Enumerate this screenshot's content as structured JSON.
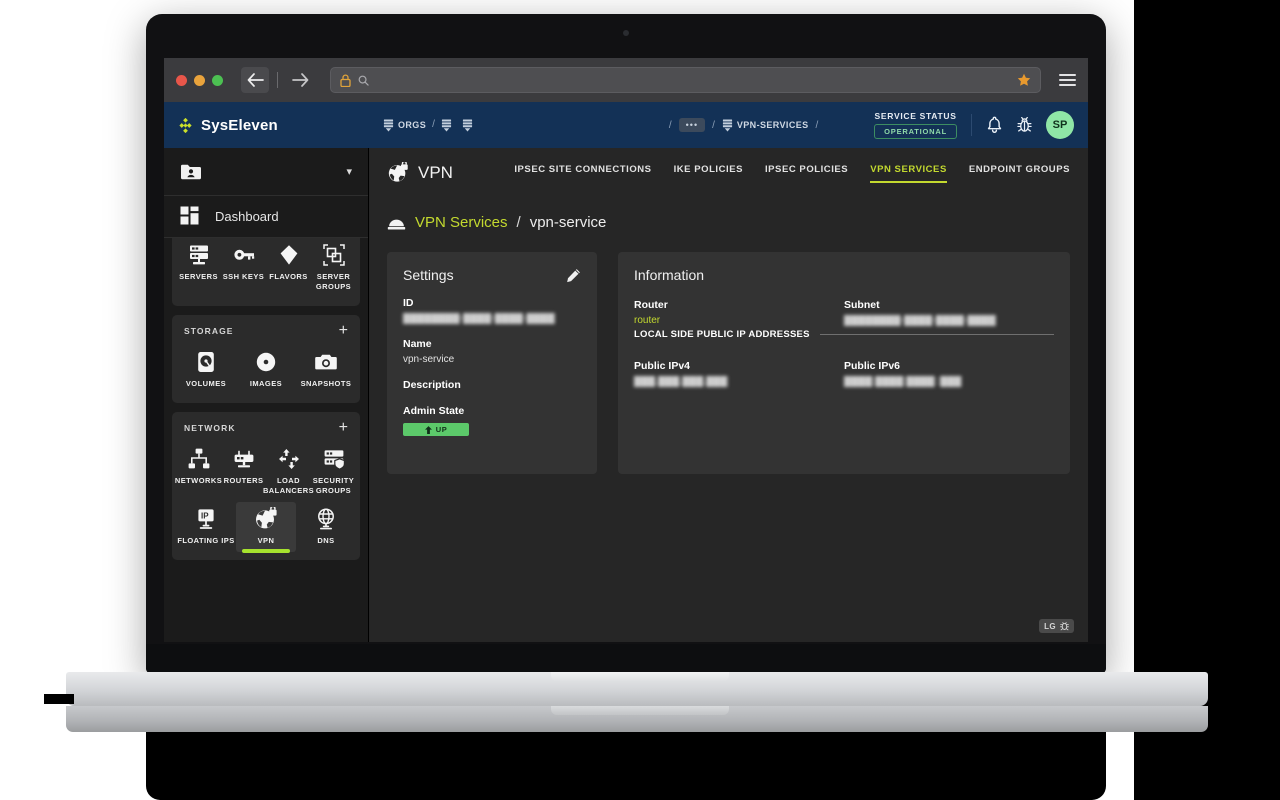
{
  "browser": {
    "traffic_lights": [
      "close",
      "minimize",
      "maximize"
    ],
    "back_icon": "arrow-left-icon",
    "forward_icon": "arrow-right-icon",
    "lock_icon": "lock-icon",
    "search_icon": "search-icon",
    "url_value": "",
    "url_placeholder": "",
    "bookmark_icon": "star-icon",
    "menu_icon": "hamburger-menu-icon"
  },
  "topbar": {
    "brand": "SysEleven",
    "brand_logo_icon": "syseleven-diamond-logo",
    "breadcrumb_left": [
      {
        "icon": "orgs-icon",
        "label": "ORGS"
      },
      {
        "icon": "project-icon",
        "label": ""
      },
      {
        "icon": "project-icon",
        "label": ""
      }
    ],
    "breadcrumb_center": [
      {
        "type": "sep",
        "label": "/"
      },
      {
        "type": "chip",
        "label": "•••"
      },
      {
        "type": "sep",
        "label": "/"
      },
      {
        "type": "item",
        "icon": "vpn-services-icon",
        "label": "VPN-SERVICES"
      },
      {
        "type": "sep",
        "label": "/"
      }
    ],
    "service_status_label": "SERVICE STATUS",
    "service_status_value": "OPERATIONAL",
    "status_color": "#8fd9a8",
    "notification_icon": "bell-icon",
    "bug_icon": "bug-icon",
    "avatar_initials": "SP",
    "avatar_color": "#8fe6a6",
    "bar_color": "#133156"
  },
  "sidebar": {
    "org_selector_label": "",
    "org_icon": "folder-user-icon",
    "chevron_icon": "chevron-down-icon",
    "dashboard_label": "Dashboard",
    "dashboard_icon": "dashboard-grid-icon",
    "groups": [
      {
        "title": "",
        "has_add": false,
        "items": [
          {
            "label": "SERVERS",
            "icon": "server-icon"
          },
          {
            "label": "SSH KEYS",
            "icon": "key-icon"
          },
          {
            "label": "FLAVORS",
            "icon": "flavor-icon"
          },
          {
            "label": "SERVER GROUPS",
            "icon": "server-groups-icon"
          }
        ]
      },
      {
        "title": "STORAGE",
        "has_add": true,
        "add_label": "+",
        "items": [
          {
            "label": "VOLUMES",
            "icon": "volume-disk-icon"
          },
          {
            "label": "IMAGES",
            "icon": "image-disc-icon"
          },
          {
            "label": "SNAPSHOTS",
            "icon": "camera-icon"
          }
        ]
      },
      {
        "title": "NETWORK",
        "has_add": true,
        "add_label": "+",
        "items": [
          {
            "label": "NETWORKS",
            "icon": "network-tree-icon"
          },
          {
            "label": "ROUTERS",
            "icon": "router-icon"
          },
          {
            "label": "LOAD BALANCERS",
            "icon": "load-balancer-icon"
          },
          {
            "label": "SECURITY GROUPS",
            "icon": "security-groups-icon"
          },
          {
            "label": "FLOATING IPS",
            "icon": "floating-ip-icon"
          },
          {
            "label": "VPN",
            "icon": "vpn-globe-lock-icon",
            "active": true
          },
          {
            "label": "DNS",
            "icon": "dns-globe-icon"
          }
        ]
      }
    ],
    "active_underline_color": "#a6e22e"
  },
  "main": {
    "page_icon": "vpn-globe-lock-icon",
    "page_title": "VPN",
    "tabs": [
      {
        "label": "IPSEC SITE CONNECTIONS",
        "active": false
      },
      {
        "label": "IKE POLICIES",
        "active": false
      },
      {
        "label": "IPSEC POLICIES",
        "active": false
      },
      {
        "label": "VPN SERVICES",
        "active": true
      },
      {
        "label": "ENDPOINT GROUPS",
        "active": false
      }
    ],
    "accent_color": "#c3d92f",
    "sub_breadcrumb": {
      "icon": "vpn-service-dome-icon",
      "link": "VPN Services",
      "separator": "/",
      "current": "vpn-service"
    },
    "settings_card": {
      "title": "Settings",
      "edit_icon": "pencil-edit-icon",
      "fields": [
        {
          "label": "ID",
          "value": "████████-████-████-████",
          "redacted": true
        },
        {
          "label": "Name",
          "value": "vpn-service",
          "redacted": false
        },
        {
          "label": "Description",
          "value": "",
          "redacted": false
        }
      ],
      "admin_state_label": "Admin State",
      "admin_state_value": "UP",
      "admin_state_icon": "arrow-up-icon",
      "admin_state_color": "#5cc96a"
    },
    "information_card": {
      "title": "Information",
      "router_label": "Router",
      "router_value": "router",
      "router_value_color": "#c3d92f",
      "subnet_label": "Subnet",
      "subnet_value": "████████-████-████-████",
      "local_side_label": "LOCAL SIDE PUBLIC IP ADDRESSES",
      "public_ipv4_label": "Public IPv4",
      "public_ipv4_value": "███.███.███.███",
      "public_ipv6_label": "Public IPv6",
      "public_ipv6_value": "████:████:████::███"
    },
    "corner_badge": {
      "label": "LG",
      "icon": "bug-icon"
    }
  }
}
